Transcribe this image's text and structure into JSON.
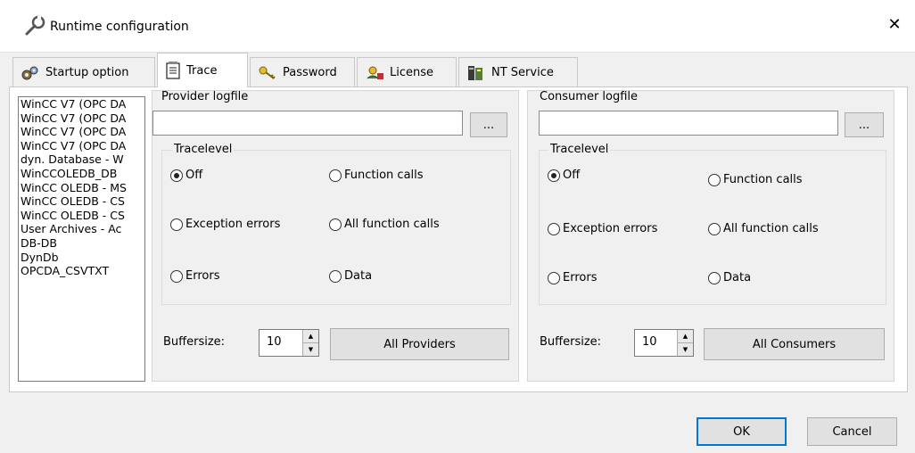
{
  "window": {
    "title": "Runtime configuration",
    "close_glyph": "✕"
  },
  "tabs": [
    {
      "label": "Startup option",
      "icon": "gears-icon"
    },
    {
      "label": "Trace",
      "icon": "notepad-icon",
      "active": true
    },
    {
      "label": "Password",
      "icon": "keys-icon"
    },
    {
      "label": "License",
      "icon": "license-icon"
    },
    {
      "label": "NT Service",
      "icon": "server-icon"
    }
  ],
  "providers": [
    "WinCC V7 (OPC DA",
    "WinCC V7 (OPC DA",
    "WinCC V7 (OPC DA",
    "WinCC V7 (OPC DA",
    "dyn. Database - W",
    "WinCCOLEDB_DB",
    "WinCC OLEDB - MS",
    "WinCC OLEDB - CS",
    "WinCC OLEDB - CS",
    "User Archives - Ac",
    "DB-DB",
    "DynDb",
    "OPCDA_CSVTXT"
  ],
  "provider": {
    "logfile_label": "Provider logfile",
    "logfile_value": "",
    "browse_label": "...",
    "tracelevel_label": "Tracelevel",
    "options": [
      "Off",
      "Function calls",
      "Exception errors",
      "All function calls",
      "Errors",
      "Data"
    ],
    "selected": "Off",
    "buffersize_label": "Buffersize:",
    "buffersize_value": "10",
    "all_button": "All Providers"
  },
  "consumer": {
    "logfile_label": "Consumer logfile",
    "logfile_value": "",
    "browse_label": "...",
    "tracelevel_label": "Tracelevel",
    "options": [
      "Off",
      "Function calls",
      "Exception errors",
      "All function calls",
      "Errors",
      "Data"
    ],
    "selected": "Off",
    "buffersize_label": "Buffersize:",
    "buffersize_value": "10",
    "all_button": "All Consumers"
  },
  "footer": {
    "ok": "OK",
    "cancel": "Cancel"
  }
}
